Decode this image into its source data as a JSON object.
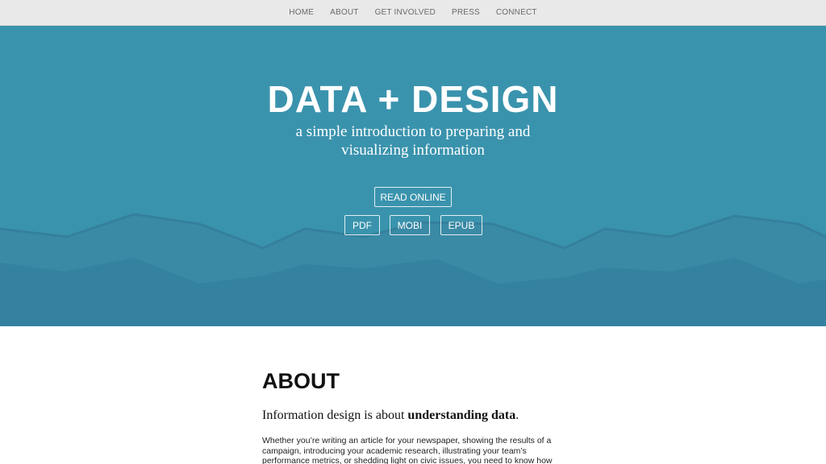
{
  "nav": {
    "items": [
      "HOME",
      "ABOUT",
      "GET INVOLVED",
      "PRESS",
      "CONNECT"
    ]
  },
  "hero": {
    "title": "DATA + DESIGN",
    "subtitle": "a simple introduction to preparing and visualizing information",
    "read_online": "READ ONLINE",
    "formats": [
      "PDF",
      "MOBI",
      "EPUB"
    ],
    "colors": {
      "background": "#3a93ad",
      "wave_back": "#3a8aa6",
      "wave_front": "#34829f"
    }
  },
  "about": {
    "heading": "ABOUT",
    "lead_prefix": "Information design is about ",
    "lead_bold": "understanding data",
    "lead_suffix": ".",
    "body": "Whether you’re writing an article for your newspaper, showing the results of a campaign, introducing your academic research, illustrating your team’s performance metrics, or shedding light on civic issues, you need to know how"
  }
}
